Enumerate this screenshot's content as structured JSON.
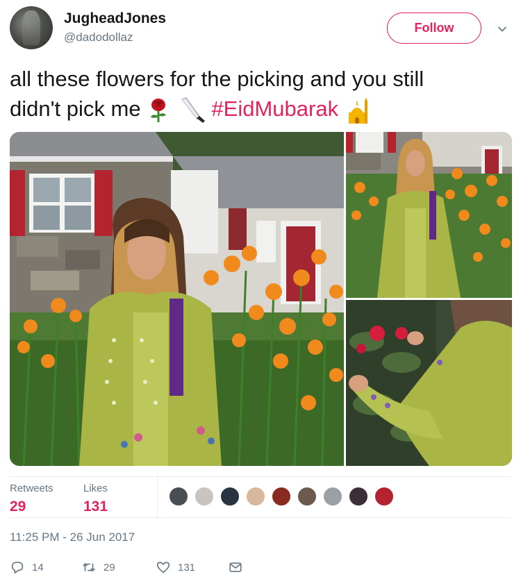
{
  "user": {
    "display_name": "JugheadJones",
    "handle": "@dadodollaz",
    "follow_label": "Follow"
  },
  "tweet": {
    "text_line1": "all these flowers for the picking and you still",
    "text_line2_start": "didn't pick me",
    "hashtag": "#EidMubarak",
    "emojis": [
      "rose",
      "knife",
      "mosque"
    ]
  },
  "stats": {
    "retweets_label": "Retweets",
    "retweets_value": "29",
    "likes_label": "Likes",
    "likes_value": "131",
    "liker_count": 9
  },
  "timestamp": "11:25 PM - 26 Jun 2017",
  "actions": {
    "reply_count": "14",
    "retweet_count": "29",
    "like_count": "131"
  },
  "colors": {
    "accent": "#e0245e",
    "secondary_text": "#657786",
    "primary_text": "#14171a",
    "divider": "#e6ecf0"
  },
  "icons": [
    "chevron-down-icon",
    "reply-icon",
    "retweet-icon",
    "heart-icon",
    "direct-message-icon"
  ]
}
